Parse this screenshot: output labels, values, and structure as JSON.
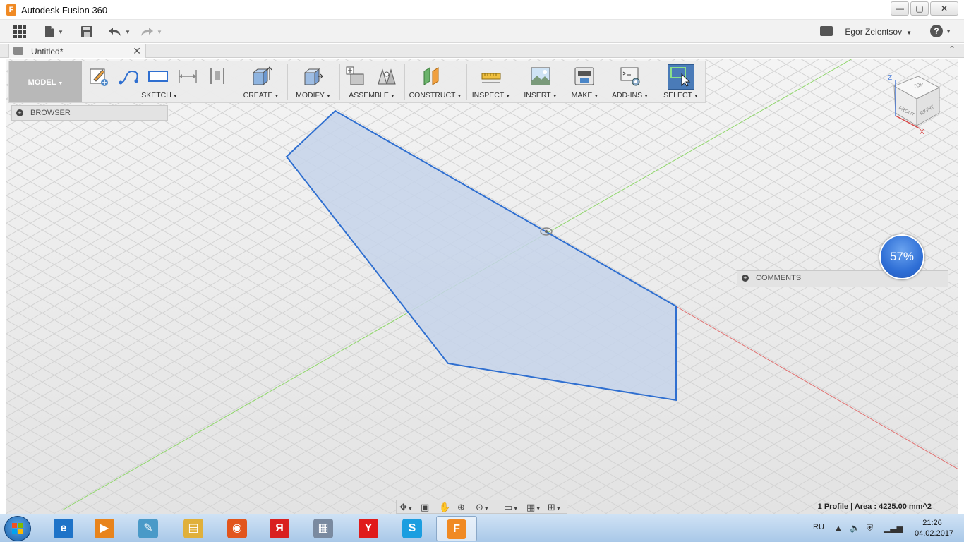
{
  "window": {
    "title": "Autodesk Fusion 360",
    "app_icon_letter": "F",
    "minimize_glyph": "—",
    "maximize_glyph": "▢",
    "close_glyph": "✕"
  },
  "quickbar": {
    "user_name": "Egor Zelentsov",
    "help_glyph": "?",
    "icons": [
      "apps-grid-icon",
      "file-icon",
      "save-icon",
      "undo-icon",
      "redo-icon",
      "notifications-icon",
      "help-icon"
    ]
  },
  "document_tab": {
    "label": "Untitled*",
    "close_glyph": "✕",
    "collapse_glyph": "⌃"
  },
  "toolbar": {
    "workspace": "MODEL",
    "groups": [
      {
        "label": "SKETCH",
        "icons": [
          "create-sketch-icon",
          "line-spline-icon",
          "rectangle-icon",
          "dimension-icon",
          "constraint-icon"
        ]
      },
      {
        "label": "CREATE",
        "icons": [
          "extrude-icon"
        ]
      },
      {
        "label": "MODIFY",
        "icons": [
          "press-pull-icon"
        ]
      },
      {
        "label": "ASSEMBLE",
        "icons": [
          "new-component-icon",
          "joint-icon"
        ]
      },
      {
        "label": "CONSTRUCT",
        "icons": [
          "offset-plane-icon"
        ]
      },
      {
        "label": "INSPECT",
        "icons": [
          "measure-icon"
        ]
      },
      {
        "label": "INSERT",
        "icons": [
          "insert-image-icon"
        ]
      },
      {
        "label": "MAKE",
        "icons": [
          "3d-print-icon"
        ]
      },
      {
        "label": "ADD-INS",
        "icons": [
          "scripts-icon"
        ]
      },
      {
        "label": "SELECT",
        "icons": [
          "select-icon"
        ]
      }
    ]
  },
  "panels": {
    "browser": "BROWSER",
    "comments": "COMMENTS",
    "plus_glyph": "+"
  },
  "viewcube": {
    "top": "TOP",
    "front": "FRONT",
    "right": "RIGHT",
    "axis_z": "Z",
    "axis_x": "X"
  },
  "progress": {
    "value": 0.57,
    "label": "57%"
  },
  "status": {
    "text": "1 Profile | Area : 4225.00 mm^2"
  },
  "navbar": {
    "icons": [
      "orbit-icon",
      "look-at-icon",
      "pan-icon",
      "zoom-icon",
      "fit-icon",
      "display-settings-icon",
      "grid-settings-icon",
      "viewports-icon"
    ]
  },
  "taskbar": {
    "apps": [
      {
        "name": "internet-explorer",
        "glyph": "e",
        "color": "#1e73c8"
      },
      {
        "name": "media-player",
        "glyph": "▶",
        "color": "#e8841c"
      },
      {
        "name": "notebook",
        "glyph": "✎",
        "color": "#4a9ac8"
      },
      {
        "name": "file-explorer",
        "glyph": "▤",
        "color": "#e0b03a"
      },
      {
        "name": "firefox",
        "glyph": "◉",
        "color": "#e2551c"
      },
      {
        "name": "yandex-browser",
        "glyph": "Я",
        "color": "#d92020"
      },
      {
        "name": "calculator",
        "glyph": "▦",
        "color": "#7a8aa0"
      },
      {
        "name": "yandex",
        "glyph": "Y",
        "color": "#e01a1a"
      },
      {
        "name": "skype",
        "glyph": "S",
        "color": "#1b9ee0"
      },
      {
        "name": "fusion-360",
        "glyph": "F",
        "color": "#f08a24"
      }
    ],
    "language": "RU",
    "time": "21:26",
    "date": "04.02.2017"
  },
  "colors": {
    "sketch_fill": "#c5d3ea",
    "sketch_stroke": "#2f6fd0",
    "axis_green": "#8fd66a",
    "axis_red": "#e07070",
    "grid": "#d6d6d6",
    "selected_tool": "#4a7bb8"
  }
}
